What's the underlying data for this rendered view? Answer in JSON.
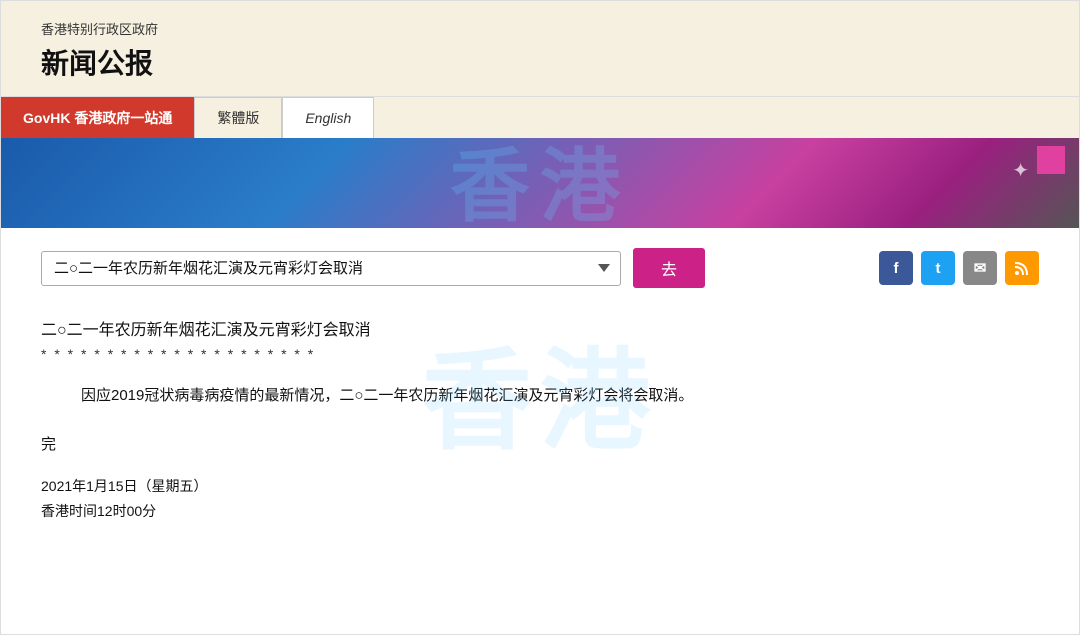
{
  "header": {
    "subtitle": "香港特别行政区政府",
    "title": "新闻公报"
  },
  "nav": {
    "main_label": "GovHK 香港政府一站通",
    "tc_label": "繁體版",
    "en_label": "English"
  },
  "banner": {
    "watermark": "香港"
  },
  "dropdown": {
    "selected_value": "二○二一年农历新年烟花汇演及元宵彩灯会取消",
    "go_label": "去"
  },
  "social": {
    "fb": "f",
    "tw": "t",
    "mail": "✉",
    "rss": "r"
  },
  "article": {
    "title": "二○二一年农历新年烟花汇演及元宵彩灯会取消",
    "stars": "* * * * * * * * * * * * * * * * * * * * *",
    "body": "因应2019冠状病毒病疫情的最新情况，二○二一年农历新年烟花汇演及元宵彩灯会将会取消。",
    "end": "完",
    "date": "2021年1月15日（星期五）",
    "time": "香港时间12时00分"
  },
  "watermark": {
    "text": "香港"
  }
}
